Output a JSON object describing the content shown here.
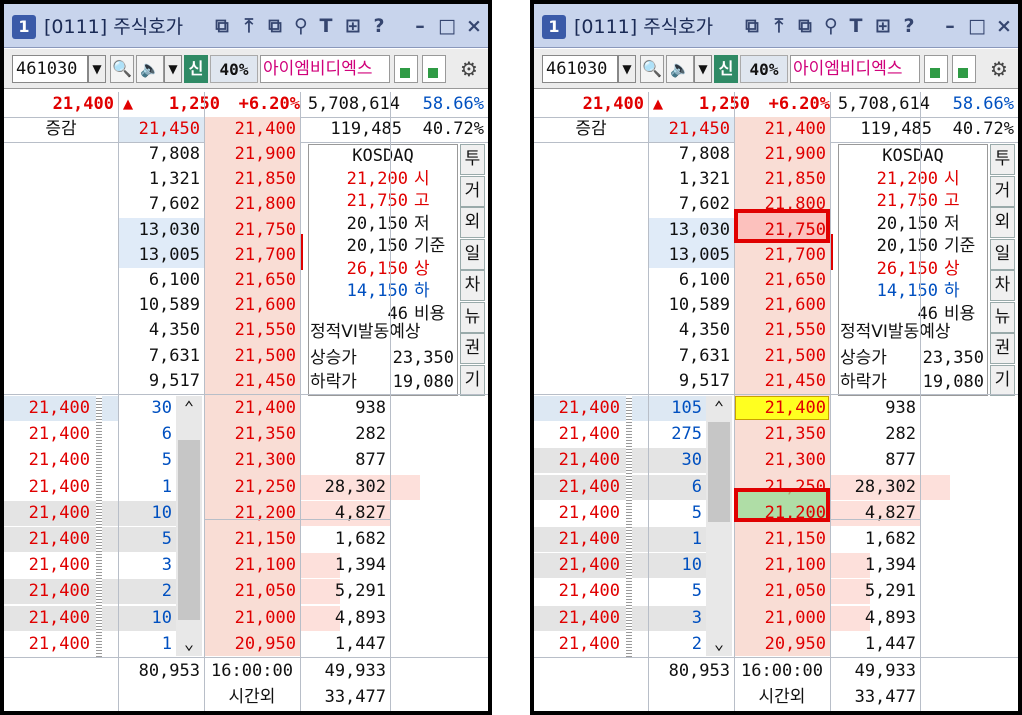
{
  "windows": [
    {
      "title": "[0111] 주식호가",
      "tnum": "1",
      "code": "461030",
      "mark": "신",
      "pct": "40%",
      "stock_name": "아이엠비디엑스",
      "summary": {
        "price": "21,400",
        "arrow": "▲",
        "change": "1,250",
        "rate": "+6.20%",
        "volume": "5,708,614",
        "ratio": "58.66%"
      },
      "zg": {
        "label": "증감",
        "ask": "21,450",
        "bid": "21,400",
        "qty": "119,485",
        "pct": "40.72%"
      },
      "asks": [
        {
          "qty": "7,808",
          "price": "21,900"
        },
        {
          "qty": "1,321",
          "price": "21,850"
        },
        {
          "qty": "7,602",
          "price": "21,800"
        },
        {
          "qty": "13,030",
          "price": "21,750"
        },
        {
          "qty": "13,005",
          "price": "21,700"
        },
        {
          "qty": "6,100",
          "price": "21,650"
        },
        {
          "qty": "10,589",
          "price": "21,600"
        },
        {
          "qty": "4,350",
          "price": "21,550"
        },
        {
          "qty": "7,631",
          "price": "21,500"
        },
        {
          "qty": "9,517",
          "price": "21,450"
        }
      ],
      "info": [
        {
          "v": "KOSDAQ",
          "l": ""
        },
        {
          "v": "21,200",
          "l": "시"
        },
        {
          "v": "21,750",
          "l": "고"
        },
        {
          "v": "20,150",
          "l": "저"
        },
        {
          "v": "20,150",
          "l": "기준"
        },
        {
          "v": "26,150",
          "l": "상"
        },
        {
          "v": "14,150",
          "l": "하"
        },
        {
          "v": "46",
          "l": "비용"
        }
      ],
      "vi": "정적VI발동예상",
      "upper": {
        "label": "상승가",
        "value": "23,350"
      },
      "lower": {
        "label": "하락가",
        "value": "19,080"
      },
      "side_buttons": [
        "투",
        "거",
        "외",
        "일",
        "차",
        "뉴",
        "권",
        "기"
      ],
      "trades": [
        {
          "price": "21,400",
          "qty": "30"
        },
        {
          "price": "21,400",
          "qty": "6"
        },
        {
          "price": "21,400",
          "qty": "5"
        },
        {
          "price": "21,400",
          "qty": "1"
        },
        {
          "price": "21,400",
          "qty": "10"
        },
        {
          "price": "21,400",
          "qty": "5"
        },
        {
          "price": "21,400",
          "qty": "3"
        },
        {
          "price": "21,400",
          "qty": "2"
        },
        {
          "price": "21,400",
          "qty": "10"
        },
        {
          "price": "21,400",
          "qty": "1"
        }
      ],
      "bids": [
        {
          "price": "21,400",
          "qty": "938"
        },
        {
          "price": "21,350",
          "qty": "282"
        },
        {
          "price": "21,300",
          "qty": "877"
        },
        {
          "price": "21,250",
          "qty": "28,302"
        },
        {
          "price": "21,200",
          "qty": "4,827"
        },
        {
          "price": "21,150",
          "qty": "1,682"
        },
        {
          "price": "21,100",
          "qty": "1,394"
        },
        {
          "price": "21,050",
          "qty": "5,291"
        },
        {
          "price": "21,000",
          "qty": "4,893"
        },
        {
          "price": "20,950",
          "qty": "1,447"
        }
      ],
      "footer": {
        "ask_total": "80,953",
        "time": "16:00:00",
        "bid_total": "49,933",
        "after_label": "시간외",
        "after_value": "33,477"
      }
    },
    {
      "title": "[0111] 주식호가",
      "tnum": "1",
      "code": "461030",
      "mark": "신",
      "pct": "40%",
      "stock_name": "아이엠비디엑스",
      "summary": {
        "price": "21,400",
        "arrow": "▲",
        "change": "1,250",
        "rate": "+6.20%",
        "volume": "5,708,614",
        "ratio": "58.66%"
      },
      "zg": {
        "label": "증감",
        "ask": "21,450",
        "bid": "21,400",
        "qty": "119,485",
        "pct": "40.72%"
      },
      "asks": [
        {
          "qty": "7,808",
          "price": "21,900"
        },
        {
          "qty": "1,321",
          "price": "21,850"
        },
        {
          "qty": "7,602",
          "price": "21,800"
        },
        {
          "qty": "13,030",
          "price": "21,750"
        },
        {
          "qty": "13,005",
          "price": "21,700"
        },
        {
          "qty": "6,100",
          "price": "21,650"
        },
        {
          "qty": "10,589",
          "price": "21,600"
        },
        {
          "qty": "4,350",
          "price": "21,550"
        },
        {
          "qty": "7,631",
          "price": "21,500"
        },
        {
          "qty": "9,517",
          "price": "21,450"
        }
      ],
      "info": [
        {
          "v": "KOSDAQ",
          "l": ""
        },
        {
          "v": "21,200",
          "l": "시"
        },
        {
          "v": "21,750",
          "l": "고"
        },
        {
          "v": "20,150",
          "l": "저"
        },
        {
          "v": "20,150",
          "l": "기준"
        },
        {
          "v": "26,150",
          "l": "상"
        },
        {
          "v": "14,150",
          "l": "하"
        },
        {
          "v": "46",
          "l": "비용"
        }
      ],
      "vi": "정적VI발동예상",
      "upper": {
        "label": "상승가",
        "value": "23,350"
      },
      "lower": {
        "label": "하락가",
        "value": "19,080"
      },
      "side_buttons": [
        "투",
        "거",
        "외",
        "일",
        "차",
        "뉴",
        "권",
        "기"
      ],
      "trades": [
        {
          "price": "21,400",
          "qty": "105"
        },
        {
          "price": "21,400",
          "qty": "275"
        },
        {
          "price": "21,400",
          "qty": "30"
        },
        {
          "price": "21,400",
          "qty": "6"
        },
        {
          "price": "21,400",
          "qty": "5"
        },
        {
          "price": "21,400",
          "qty": "1"
        },
        {
          "price": "21,400",
          "qty": "10"
        },
        {
          "price": "21,400",
          "qty": "5"
        },
        {
          "price": "21,400",
          "qty": "3"
        },
        {
          "price": "21,400",
          "qty": "2"
        }
      ],
      "bids": [
        {
          "price": "21,400",
          "qty": "938"
        },
        {
          "price": "21,350",
          "qty": "282"
        },
        {
          "price": "21,300",
          "qty": "877"
        },
        {
          "price": "21,250",
          "qty": "28,302"
        },
        {
          "price": "21,200",
          "qty": "4,827"
        },
        {
          "price": "21,150",
          "qty": "1,682"
        },
        {
          "price": "21,100",
          "qty": "1,394"
        },
        {
          "price": "21,050",
          "qty": "5,291"
        },
        {
          "price": "21,000",
          "qty": "4,893"
        },
        {
          "price": "20,950",
          "qty": "1,447"
        }
      ],
      "footer": {
        "ask_total": "80,953",
        "time": "16:00:00",
        "bid_total": "49,933",
        "after_label": "시간외",
        "after_value": "33,477"
      }
    }
  ],
  "colors": {
    "up": "#e00000",
    "down": "#0050c0",
    "highlight": "#ffff20",
    "box": "#e00000"
  }
}
